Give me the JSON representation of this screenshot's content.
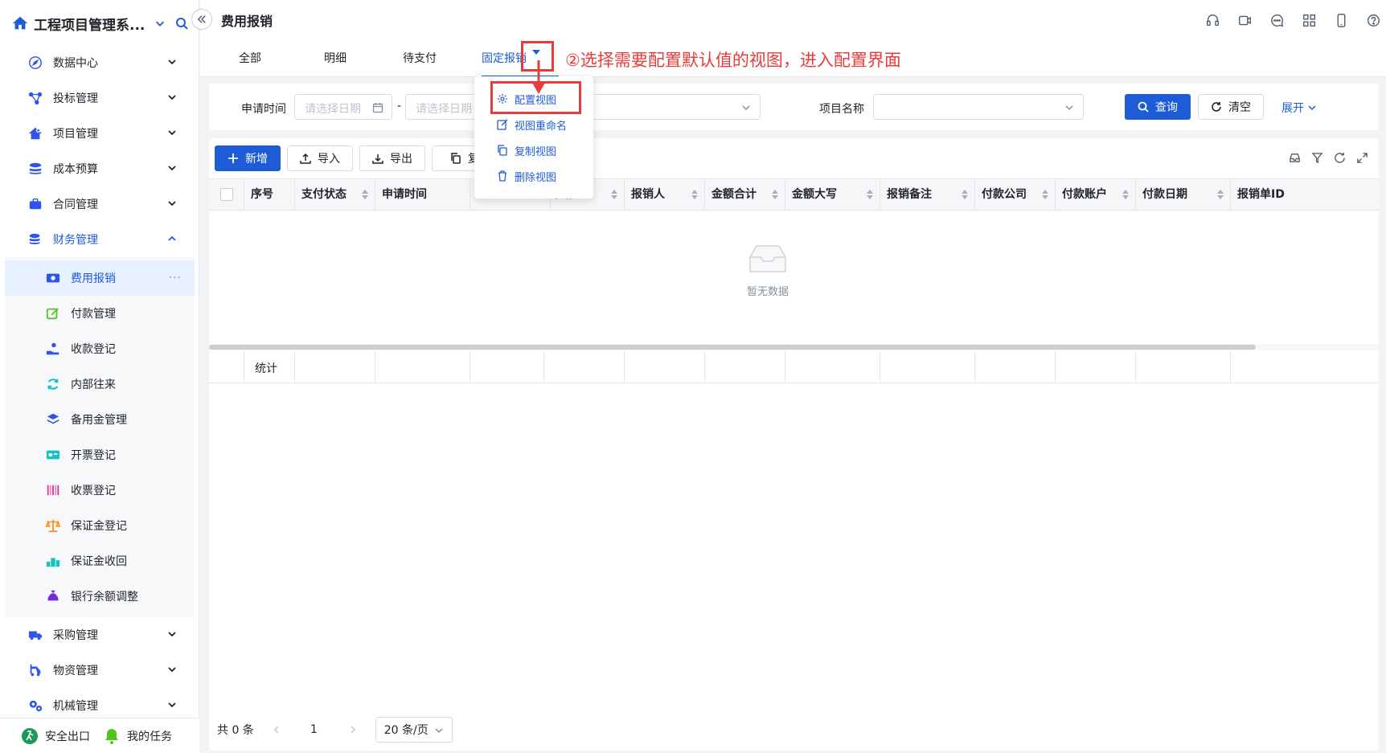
{
  "app": {
    "title": "工程项目管理系..."
  },
  "sidebar": {
    "menu": [
      {
        "label": "数据中心",
        "icon": "compass-icon"
      },
      {
        "label": "投标管理",
        "icon": "network-icon"
      },
      {
        "label": "项目管理",
        "icon": "house-gear-icon"
      },
      {
        "label": "成本预算",
        "icon": "stack-icon"
      },
      {
        "label": "合同管理",
        "icon": "briefcase-icon"
      },
      {
        "label": "财务管理",
        "icon": "coins-icon"
      }
    ],
    "finance_sub": [
      {
        "label": "费用报销",
        "icon": "money-icon",
        "color": "#2f54eb",
        "active": true
      },
      {
        "label": "付款管理",
        "icon": "edit-icon",
        "color": "#52c41a"
      },
      {
        "label": "收款登记",
        "icon": "hand-coin-icon",
        "color": "#2f54eb"
      },
      {
        "label": "内部往来",
        "icon": "refresh-icon",
        "color": "#13c2c2"
      },
      {
        "label": "备用金管理",
        "icon": "layers-icon",
        "color": "#2f54eb"
      },
      {
        "label": "开票登记",
        "icon": "invoice-icon",
        "color": "#13c2c2"
      },
      {
        "label": "收票登记",
        "icon": "barcode-icon",
        "color": "#eb2f96"
      },
      {
        "label": "保证金登记",
        "icon": "scale-icon",
        "color": "#fa8c16"
      },
      {
        "label": "保证金收回",
        "icon": "podium-icon",
        "color": "#13c2c2"
      },
      {
        "label": "银行余额调整",
        "icon": "money-bag-icon",
        "color": "#722ed1"
      }
    ],
    "menu_bottom": [
      {
        "label": "采购管理",
        "icon": "truck-icon"
      },
      {
        "label": "物资管理",
        "icon": "forklift-icon"
      },
      {
        "label": "机械管理",
        "icon": "gears-icon"
      }
    ],
    "footer": {
      "exit": "安全出口",
      "tasks": "我的任务"
    },
    "more": "···"
  },
  "header": {
    "title": "费用报销",
    "icons": [
      "headset-icon",
      "video-icon",
      "chat-icon",
      "apps-icon",
      "phone-icon",
      "help-icon"
    ]
  },
  "tabs": [
    "全部",
    "明细",
    "待支付",
    "固定报销"
  ],
  "annotation": "②选择需要配置默认值的视图，进入配置界面",
  "dropdown": [
    "配置视图",
    "视图重命名",
    "复制视图",
    "删除视图"
  ],
  "filter": {
    "apply_time_label": "申请时间",
    "date_placeholder_start": "请选择日期",
    "date_placeholder_end": "请选择日期",
    "dash": "-",
    "project_label": "项目名称",
    "query": "查询",
    "clear": "清空",
    "expand": "展开"
  },
  "toolbar": {
    "add": "新增",
    "import": "导入",
    "export": "导出",
    "copy": "复"
  },
  "table": {
    "columns": [
      "序号",
      "支付状态",
      "申请时间",
      "",
      "",
      "申请人",
      "报销人",
      "金额合计",
      "金额大写",
      "报销备注",
      "付款公司",
      "付款账户",
      "付款日期",
      "报销单ID"
    ],
    "empty_text": "暂无数据",
    "summary_label": "统计"
  },
  "pagination": {
    "total": "共 0 条",
    "page": "1",
    "page_size": "20 条/页"
  },
  "colors": {
    "accent": "#1e5bd6",
    "annotation": "#e83b3b"
  }
}
